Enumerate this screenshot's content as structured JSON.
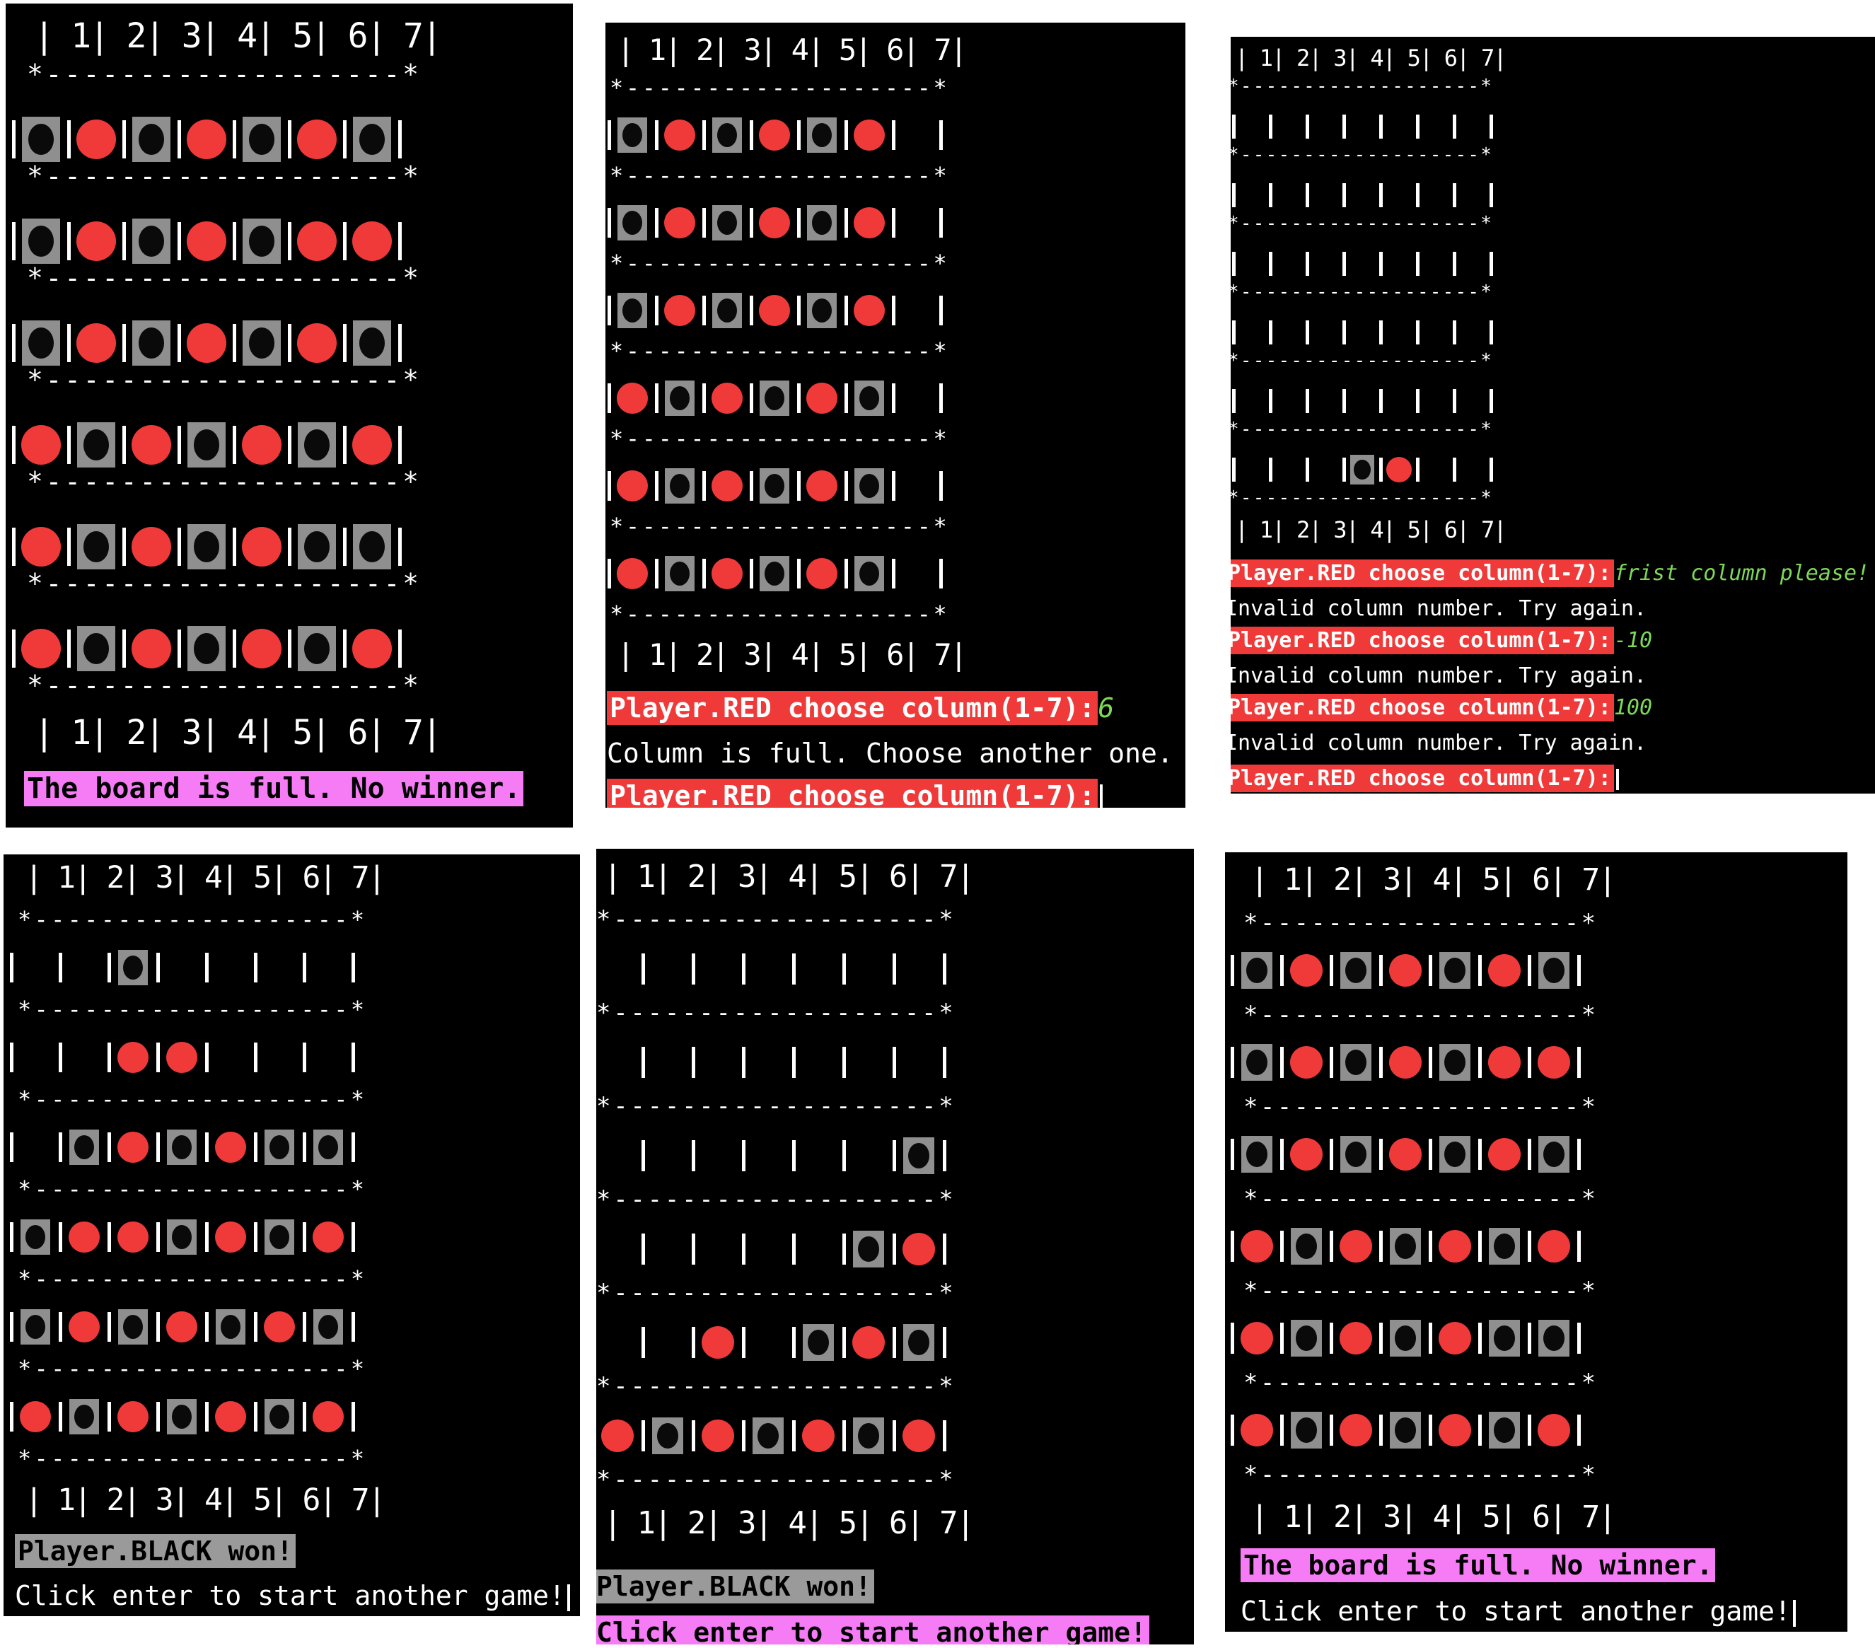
{
  "column_header": "| 1| 2| 3| 4| 5| 6| 7|",
  "row_separator": "*-------------------*",
  "colors": {
    "terminal_bg": "#000000",
    "red_piece": "#f03a3a",
    "black_piece_bg": "#8f8f8f",
    "prompt_bg": "#f03a3a",
    "no_winner_bg": "#f57cf5",
    "black_won_bg": "#9a9a9a",
    "input_text": "#7ed957"
  },
  "panels": [
    {
      "id": "p1",
      "board": [
        "BRBRBRB",
        "BRBRBRR",
        "BRBRBRB",
        "RBRBRBR",
        "RBRBRBB",
        "RBRBRBR"
      ],
      "messages": [
        {
          "kind": "highlight",
          "bg": "#f57cf5",
          "text": "The board is full. No winner."
        }
      ]
    },
    {
      "id": "p2",
      "board": [
        "BRBRBR.",
        "BRBRBR.",
        "BRBRBR.",
        "RBRBRB.",
        "RBRBRB.",
        "RBRBRB."
      ],
      "messages": [
        {
          "kind": "prompt",
          "text": "Player.RED choose column(1-7):",
          "input": "6"
        },
        {
          "kind": "plain",
          "text": "Column is full. Choose another one."
        },
        {
          "kind": "prompt",
          "text": "Player.RED choose column(1-7):",
          "input": "",
          "cursor": true
        }
      ]
    },
    {
      "id": "p3",
      "board": [
        ".......",
        ".......",
        ".......",
        ".......",
        ".......",
        "...BR.."
      ],
      "messages": [
        {
          "kind": "prompt",
          "text": "Player.RED choose column(1-7):",
          "input": "frist column please!"
        },
        {
          "kind": "plain",
          "text": "Invalid column number. Try again."
        },
        {
          "kind": "prompt",
          "text": "Player.RED choose column(1-7):",
          "input": "-10"
        },
        {
          "kind": "plain",
          "text": "Invalid column number. Try again."
        },
        {
          "kind": "prompt",
          "text": "Player.RED choose column(1-7):",
          "input": "100"
        },
        {
          "kind": "plain",
          "text": "Invalid column number. Try again."
        },
        {
          "kind": "prompt",
          "text": "Player.RED choose column(1-7):",
          "input": "",
          "cursor": true
        }
      ]
    },
    {
      "id": "p4",
      "board": [
        "..B....",
        "..RR...",
        ".BRBRBB",
        "BRRBRBR",
        "BRBRBRB",
        "RBRBRBR"
      ],
      "messages": [
        {
          "kind": "highlight",
          "bg": "#9a9a9a",
          "text": "Player.BLACK won!"
        },
        {
          "kind": "plain",
          "text": "Click enter to start another game!",
          "cursor": true
        }
      ]
    },
    {
      "id": "p5",
      "board": [
        ".......",
        ".......",
        "......B",
        ".....BR",
        "..R.BRB",
        "RBRBRBR"
      ],
      "messages": [
        {
          "kind": "highlight",
          "bg": "#9a9a9a",
          "text": "Player.BLACK won!"
        },
        {
          "kind": "highlight",
          "bg": "#f57cf5",
          "text": "Click enter to start another game!"
        }
      ]
    },
    {
      "id": "p6",
      "board": [
        "BRBRBRB",
        "BRBRBRR",
        "BRBRBRB",
        "RBRBRBR",
        "RBRBRBB",
        "RBRBRBR"
      ],
      "messages": [
        {
          "kind": "highlight",
          "bg": "#f57cf5",
          "text": "The board is full. No winner."
        },
        {
          "kind": "plain",
          "text": "Click enter to start another game!",
          "cursor": true
        }
      ]
    }
  ]
}
